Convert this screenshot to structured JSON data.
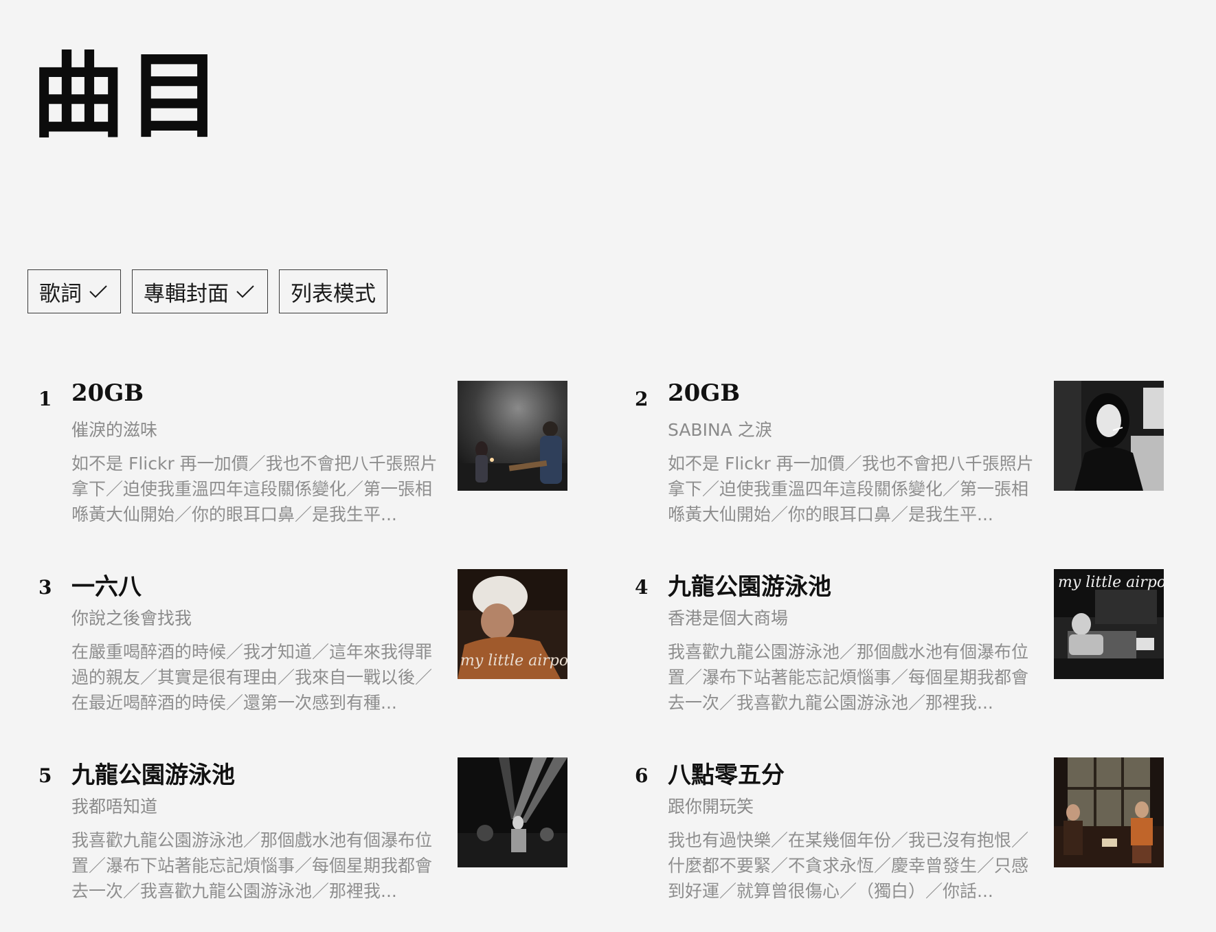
{
  "page": {
    "title": "曲目"
  },
  "toggles": [
    {
      "label": "歌詞",
      "checked": true
    },
    {
      "label": "專輯封面",
      "checked": true
    },
    {
      "label": "列表模式",
      "checked": false
    }
  ],
  "songs": [
    {
      "number": "1",
      "title": "20GB",
      "album": "催淚的滋味",
      "lyrics": "如不是 Flickr 再一加價／我也不會把八千張照片拿下／迫使我重溫四年這段關係變化／第一張相喺黃大仙開始／你的眼耳口鼻／是我生平...",
      "cover": "cover-concert-duo"
    },
    {
      "number": "2",
      "title": "20GB",
      "album": "SABINA 之淚",
      "lyrics": "如不是 Flickr 再一加價／我也不會把八千張照片拿下／迫使我重溫四年這段關係變化／第一張相喺黃大仙開始／你的眼耳口鼻／是我生平...",
      "cover": "cover-smoking-woman"
    },
    {
      "number": "3",
      "title": "一六八",
      "album": "你說之後會找我",
      "lyrics": "在嚴重喝醉酒的時候／我才知道／這年來我得罪過的親友／其實是很有理由／我來自一戰以後／在最近喝醉酒的時侯／還第一次感到有種...",
      "cover": "cover-beanie-woman",
      "cover_text": "my little airport"
    },
    {
      "number": "4",
      "title": "九龍公園游泳池",
      "album": "香港是個大商場",
      "lyrics": "我喜歡九龍公園游泳池／那個戲水池有個瀑布位置／瀑布下站著能忘記煩惱事／每個星期我都會去一次／我喜歡九龍公園游泳池／那裡我...",
      "cover": "cover-room-window",
      "cover_text": "my little airport"
    },
    {
      "number": "5",
      "title": "九龍公園游泳池",
      "album": "我都唔知道",
      "lyrics": "我喜歡九龍公園游泳池／那個戲水池有個瀑布位置／瀑布下站著能忘記煩惱事／每個星期我都會去一次／我喜歡九龍公園游泳池／那裡我...",
      "cover": "cover-stage-lights"
    },
    {
      "number": "6",
      "title": "八點零五分",
      "album": "跟你開玩笑",
      "lyrics": "我也有過快樂／在某幾個年份／我已沒有抱恨／什麼都不要緊／不貪求永恆／慶幸曾發生／只感到好運／就算曾很傷心／（獨白）／你話...",
      "cover": "cover-two-women-window"
    }
  ]
}
